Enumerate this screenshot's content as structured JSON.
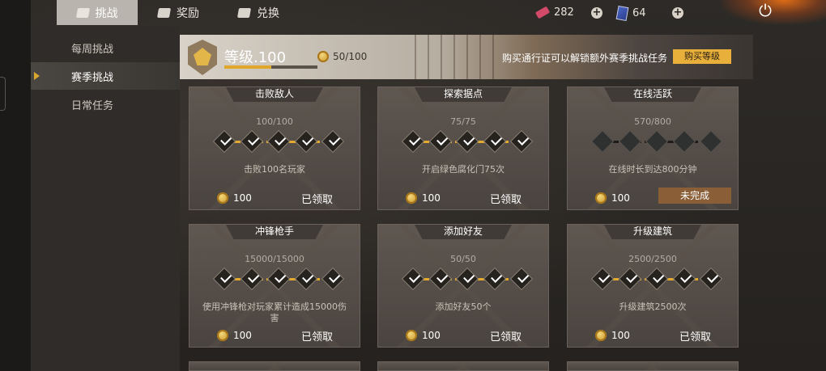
{
  "tabs": [
    {
      "label": "挑战",
      "active": true
    },
    {
      "label": "奖励",
      "active": false
    },
    {
      "label": "兑换",
      "active": false
    }
  ],
  "resources": {
    "tickets": "282",
    "cards": "64"
  },
  "sidebar": [
    {
      "label": "每周挑战",
      "active": false
    },
    {
      "label": "赛季挑战",
      "active": true
    },
    {
      "label": "日常任务",
      "active": false
    }
  ],
  "level": {
    "title": "等级.100",
    "xp": "50/100",
    "xp_fraction": 0.5,
    "promo": "购买通行证可以解锁额外赛季挑战任务",
    "buy_label": "购买等级"
  },
  "cards": [
    {
      "title": "击败敌人",
      "progress": "100/100",
      "desc": "击败100名玩家",
      "reward": "100",
      "status": "已领取",
      "done": 5,
      "completed": true
    },
    {
      "title": "探索据点",
      "progress": "75/75",
      "desc": "开启绿色腐化门75次",
      "reward": "100",
      "status": "已领取",
      "done": 5,
      "completed": true
    },
    {
      "title": "在线活跃",
      "progress": "570/800",
      "desc": "在线时长到达800分钟",
      "reward": "100",
      "status": "未完成",
      "done": 0,
      "completed": false
    },
    {
      "title": "冲锋枪手",
      "progress": "15000/15000",
      "desc": "使用冲锋枪对玩家累计造成15000伤害",
      "reward": "100",
      "status": "已领取",
      "done": 5,
      "completed": true
    },
    {
      "title": "添加好友",
      "progress": "50/50",
      "desc": "添加好友50个",
      "reward": "100",
      "status": "已领取",
      "done": 5,
      "completed": true
    },
    {
      "title": "升级建筑",
      "progress": "2500/2500",
      "desc": "升级建筑2500次",
      "reward": "100",
      "status": "已领取",
      "done": 5,
      "completed": true
    }
  ],
  "colors": {
    "accent": "#e3aa2e",
    "button": "#e8b03a",
    "incomplete_button": "#8a5f38"
  }
}
